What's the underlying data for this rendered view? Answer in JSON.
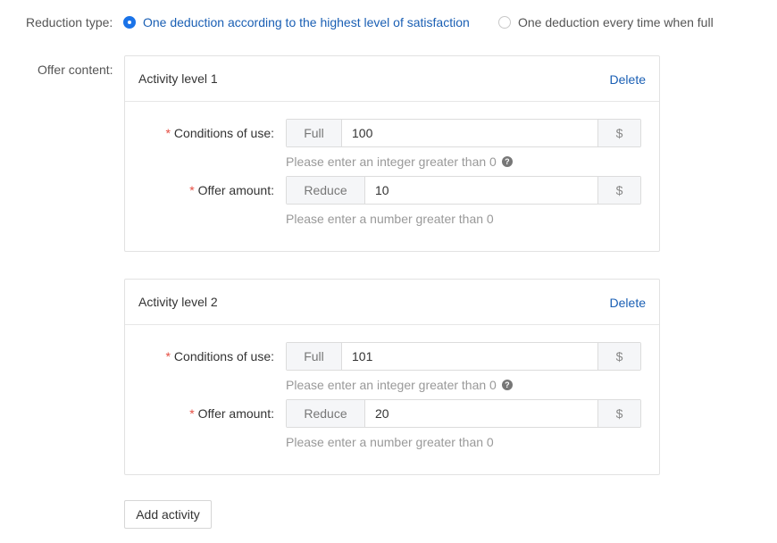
{
  "reduction": {
    "label": "Reduction type:",
    "options": [
      {
        "label": "One deduction according to the highest level of satisfaction",
        "checked": true
      },
      {
        "label": "One deduction every time when full",
        "checked": false
      }
    ]
  },
  "offer": {
    "label": "Offer content:",
    "levels": [
      {
        "title": "Activity level 1",
        "delete_label": "Delete",
        "condition_label": "Conditions of use:",
        "condition_prefix": "Full",
        "condition_value": "100",
        "condition_suffix": "$",
        "condition_hint": "Please enter an integer greater than 0",
        "amount_label": "Offer amount:",
        "amount_prefix": "Reduce",
        "amount_value": "10",
        "amount_suffix": "$",
        "amount_hint": "Please enter a number greater than 0"
      },
      {
        "title": "Activity level 2",
        "delete_label": "Delete",
        "condition_label": "Conditions of use:",
        "condition_prefix": "Full",
        "condition_value": "101",
        "condition_suffix": "$",
        "condition_hint": "Please enter an integer greater than 0",
        "amount_label": "Offer amount:",
        "amount_prefix": "Reduce",
        "amount_value": "20",
        "amount_suffix": "$",
        "amount_hint": "Please enter a number greater than 0"
      }
    ]
  },
  "required_mark": "*",
  "help_glyph": "?",
  "add_activity_label": "Add activity",
  "colors": {
    "accent": "#1a73e8",
    "link": "#1a5fb4",
    "required": "#e54d42",
    "hint": "#999999"
  }
}
